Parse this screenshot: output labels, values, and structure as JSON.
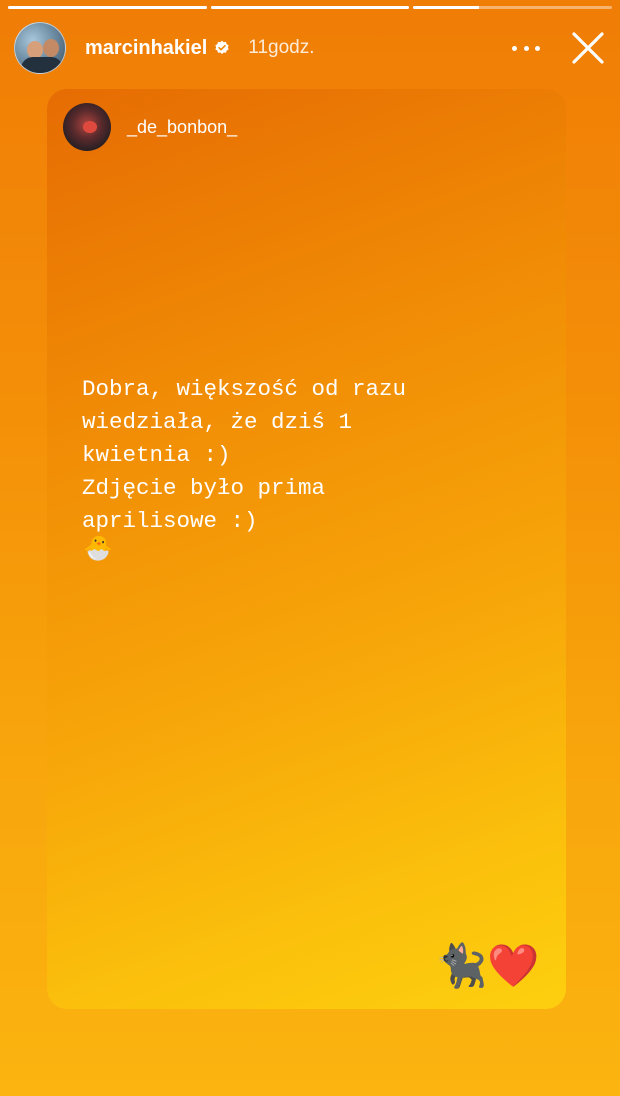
{
  "progress": [
    1.0,
    1.0,
    0.33
  ],
  "header": {
    "username": "marcinhakiel",
    "time": "11godz.",
    "verified_color": "#ffffff"
  },
  "icons": {
    "more": "more-horizontal-icon",
    "close": "close-icon",
    "verified": "verified-badge-icon"
  },
  "shared_post": {
    "username": "_de_bonbon_",
    "text": "Dobra, większość od razu\nwiedziała, że dziś 1\nkwietnia :)\nZdjęcie było prima\naprilisowe :)",
    "emoji": "🐣",
    "stickers": [
      "🐈‍⬛",
      "❤️"
    ]
  },
  "colors": {
    "background_top": "#f07d06",
    "background_bottom": "#fbb410",
    "card_top": "#e66c03",
    "card_bottom": "#fdcf0f"
  }
}
